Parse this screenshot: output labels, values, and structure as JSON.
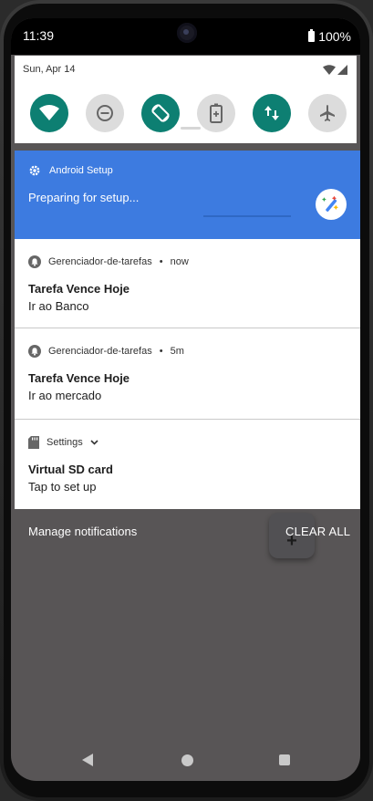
{
  "status_bar": {
    "time": "11:39",
    "battery": "100%"
  },
  "quick_settings": {
    "date": "Sun, Apr 14",
    "tiles": [
      {
        "icon": "wifi-icon",
        "state": "on"
      },
      {
        "icon": "do-not-disturb-icon",
        "state": "off"
      },
      {
        "icon": "auto-rotate-icon",
        "state": "on"
      },
      {
        "icon": "battery-saver-icon",
        "state": "off"
      },
      {
        "icon": "mobile-data-icon",
        "state": "on"
      },
      {
        "icon": "airplane-mode-icon",
        "state": "off"
      }
    ]
  },
  "setup_notification": {
    "app": "Android Setup",
    "text": "Preparing for setup..."
  },
  "notifications": [
    {
      "app": "Gerenciador-de-tarefas",
      "time": "now",
      "title": "Tarefa Vence Hoje",
      "text": "Ir ao Banco"
    },
    {
      "app": "Gerenciador-de-tarefas",
      "time": "5m",
      "title": "Tarefa Vence Hoje",
      "text": "Ir ao mercado"
    },
    {
      "app": "Settings",
      "time": "",
      "title": "Virtual SD card",
      "text": "Tap to set up"
    }
  ],
  "footer": {
    "manage": "Manage notifications",
    "clear_all": "CLEAR ALL",
    "fab_symbol": "+"
  },
  "colors": {
    "accent_teal": "#0d7f72",
    "setup_blue": "#3d7be0",
    "shade_bg": "#585556"
  }
}
